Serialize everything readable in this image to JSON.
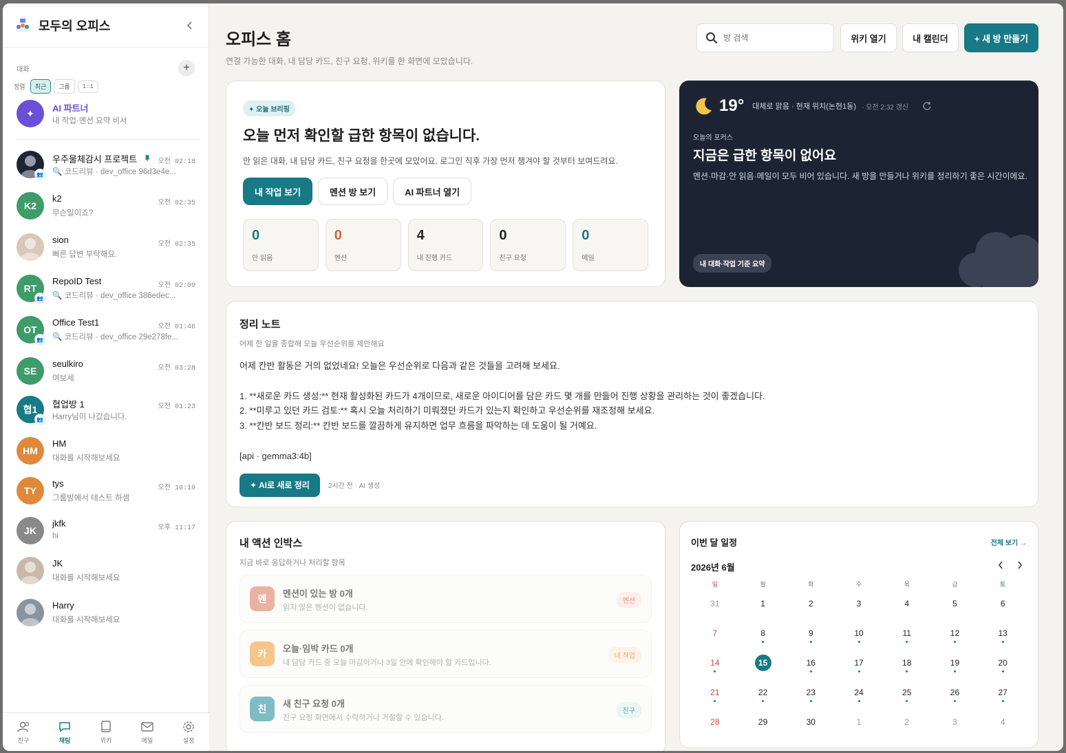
{
  "sidebar": {
    "brand": "모두의 오피스",
    "section_title": "대화",
    "sort_label": "정렬",
    "sort_options": [
      "최근",
      "그룹",
      "1:1"
    ],
    "conversations": [
      {
        "name": "AI 파트너",
        "preview": "내 작업·멘션 요약 비서",
        "time": "",
        "initials": "✦",
        "color": "#6c4fd8",
        "ai": true
      },
      {
        "name": "우주물체감시 프로젝트",
        "preview": "🔍 코드리뷰 · dev_office 96d3e4e...",
        "time": "오전 02:18",
        "initials": "",
        "color": "#1d2435",
        "group": true,
        "pinned": true,
        "photo": true
      },
      {
        "name": "k2",
        "preview": "무슨일이죠?",
        "time": "오전 02:35",
        "initials": "K2",
        "color": "#3e9c6a"
      },
      {
        "name": "sion",
        "preview": "빠른 답변 부탁해요.",
        "time": "오전 02:35",
        "initials": "",
        "color": "#d8c8b8",
        "photo": true
      },
      {
        "name": "RepoID Test",
        "preview": "🔍 코드리뷰 · dev_office 386edec...",
        "time": "오전 02:09",
        "initials": "RT",
        "color": "#3e9c6a",
        "group": true
      },
      {
        "name": "Office Test1",
        "preview": "🔍 코드리뷰 · dev_office 29e278fe...",
        "time": "오전 01:46",
        "initials": "OT",
        "color": "#3e9c6a",
        "group": true
      },
      {
        "name": "seulkiro",
        "preview": "여보세",
        "time": "오전 03:28",
        "initials": "SE",
        "color": "#3e9c6a"
      },
      {
        "name": "협업방 1",
        "preview": "Harry님이 나갔습니다.",
        "time": "오전 01:23",
        "initials": "협1",
        "color": "#177a86",
        "group": true
      },
      {
        "name": "HM",
        "preview": "대화를 시작해보세요",
        "time": "",
        "initials": "HM",
        "color": "#e0893a"
      },
      {
        "name": "tys",
        "preview": "그룹방에서 테스트 하셈",
        "time": "오전 10:19",
        "initials": "TY",
        "color": "#e0893a"
      },
      {
        "name": "jkfk",
        "preview": "hi",
        "time": "오후 11:17",
        "initials": "JK",
        "color": "#8a8a8a"
      },
      {
        "name": "JK",
        "preview": "대화를 시작해보세요",
        "time": "",
        "initials": "",
        "color": "#c9b8a8",
        "photo": true
      },
      {
        "name": "Harry",
        "preview": "대화를 시작해보세요",
        "time": "",
        "initials": "",
        "color": "#8a949e",
        "photo": true
      }
    ],
    "nav": [
      {
        "label": "친구",
        "icon": "friends-icon"
      },
      {
        "label": "채팅",
        "icon": "chat-icon",
        "active": true
      },
      {
        "label": "위키",
        "icon": "wiki-icon"
      },
      {
        "label": "메일",
        "icon": "mail-icon"
      },
      {
        "label": "설정",
        "icon": "settings-icon"
      }
    ]
  },
  "header": {
    "title": "오피스 홈",
    "subtitle": "연결 가능한 대화, 내 담당 카드, 친구 요청, 위키를 한 화면에 모았습니다.",
    "search_placeholder": "방 검색",
    "wiki_button": "위키 열기",
    "calendar_button": "내 캘린더",
    "new_room_button": "+ 새 방 만들기"
  },
  "briefing": {
    "pill": "✦ 오늘 브리핑",
    "title": "오늘 먼저 확인할 급한 항목이 없습니다.",
    "desc": "안 읽은 대화, 내 담당 카드, 친구 요청을 한곳에 모았어요. 로그인 직후 가장 먼저 챙겨야 할 것부터 보여드려요.",
    "buttons": [
      "내 작업 보기",
      "멘션 방 보기",
      "AI 파트너 열기"
    ],
    "stats": [
      {
        "value": "0",
        "label": "안 읽음",
        "color": "#177a86"
      },
      {
        "value": "0",
        "label": "멘션",
        "color": "#d2633a"
      },
      {
        "value": "4",
        "label": "내 진행 카드",
        "color": "#222222"
      },
      {
        "value": "0",
        "label": "친구 요청",
        "color": "#222222"
      },
      {
        "value": "0",
        "label": "메일",
        "color": "#177a86"
      }
    ]
  },
  "weather": {
    "temp": "19°",
    "condition": "대체로 맑음 · 현재 위치(논현1동)",
    "updated": "· 오전 2:32 갱신",
    "focus_label": "오늘의 포커스",
    "focus_title": "지금은 급한 항목이 없어요",
    "focus_desc": "멘션·마감·안 읽음·메일이 모두 비어 있습니다. 새 방을 만들거나 위키를 정리하기 좋은 시간이에요.",
    "summary_chip": "내 대화·작업 기준 요약"
  },
  "note": {
    "title": "정리 노트",
    "subtitle": "어제 한 일을 종합해 오늘 우선순위를 제안해요",
    "body": "어제 칸반 활동은 거의 없었네요! 오늘은 우선순위로 다음과 같은 것들을 고려해 보세요.\n\n1.  **새로운 카드 생성:** 현재 활성화된 카드가 4개이므로, 새로운 아이디어를 담은 카드 몇 개를 만들어 진행 상황을 관리하는 것이 좋겠습니다.\n2.  **미루고 있던 카드 검토:** 혹시 오늘 처리하기 미뤄졌던 카드가 있는지 확인하고 우선순위를 재조정해 보세요.\n3.  **칸반 보드 정리:** 칸반 보드를 깔끔하게 유지하면 업무 흐름을 파악하는 데 도움이 될 거예요.\n\n[api · gemma3:4b]",
    "button": "✦ AI로 새로 정리",
    "meta": "2시간 전 · AI 생성"
  },
  "inbox": {
    "title": "내 액션 인박스",
    "subtitle": "지금 바로 응답하거나 처리할 항목",
    "items": [
      {
        "icon": "멘",
        "title": "멘션이 있는 방 0개",
        "desc": "읽지 않은 멘션이 없습니다.",
        "tag": "멘션",
        "icon_color": "#e08a70",
        "tag_bg": "#fbe6df",
        "tag_color": "#d2633a"
      },
      {
        "icon": "카",
        "title": "오늘·임박 카드 0개",
        "desc": "내 담당 카드 중 오늘 마감이거나 3일 안에 확인해야 할 카드입니다.",
        "tag": "내 작업",
        "icon_color": "#f2a84a",
        "tag_bg": "#fdeeda",
        "tag_color": "#d2843a"
      },
      {
        "icon": "친",
        "title": "새 친구 요청 0개",
        "desc": "친구 요청 화면에서 수락하거나 거절할 수 있습니다.",
        "tag": "친구",
        "icon_color": "#3a9aa5",
        "tag_bg": "#dff0f0",
        "tag_color": "#177a86"
      }
    ]
  },
  "calendar": {
    "title": "이번 달 일정",
    "view_all": "전체 보기 →",
    "month": "2026년 6월",
    "weekdays": [
      "일",
      "월",
      "화",
      "수",
      "목",
      "금",
      "토"
    ],
    "weeks": [
      [
        {
          "d": "31",
          "m": true
        },
        {
          "d": "1"
        },
        {
          "d": "2"
        },
        {
          "d": "3"
        },
        {
          "d": "4"
        },
        {
          "d": "5"
        },
        {
          "d": "6"
        }
      ],
      [
        {
          "d": "7"
        },
        {
          "d": "8",
          "dot": true
        },
        {
          "d": "9",
          "dot": true
        },
        {
          "d": "10",
          "dot": true
        },
        {
          "d": "11",
          "dot": true
        },
        {
          "d": "12",
          "dot": true
        },
        {
          "d": "13",
          "dot": true
        }
      ],
      [
        {
          "d": "14",
          "dot": true
        },
        {
          "d": "15",
          "dot": true,
          "today": true
        },
        {
          "d": "16",
          "dot": true
        },
        {
          "d": "17",
          "dot": true
        },
        {
          "d": "18",
          "dot": true
        },
        {
          "d": "19",
          "dot": true
        },
        {
          "d": "20",
          "dot": true
        }
      ],
      [
        {
          "d": "21",
          "dot": true
        },
        {
          "d": "22",
          "dot": true
        },
        {
          "d": "23",
          "dot": true
        },
        {
          "d": "24",
          "dot": true
        },
        {
          "d": "25",
          "dot": true
        },
        {
          "d": "26",
          "dot": true
        },
        {
          "d": "27",
          "dot": true
        }
      ],
      [
        {
          "d": "28"
        },
        {
          "d": "29"
        },
        {
          "d": "30"
        },
        {
          "d": "1",
          "m": true
        },
        {
          "d": "2",
          "m": true
        },
        {
          "d": "3",
          "m": true
        },
        {
          "d": "4",
          "m": true
        }
      ]
    ]
  }
}
